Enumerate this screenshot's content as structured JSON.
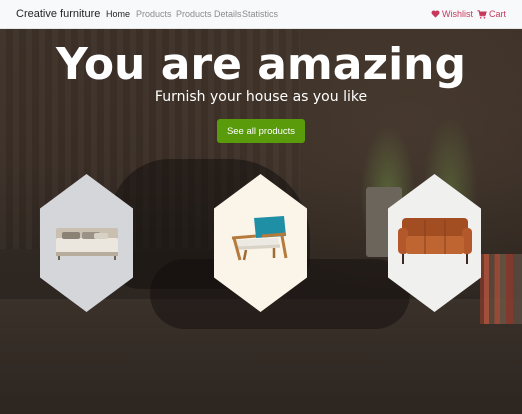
{
  "navbar": {
    "brand": "Creative furniture",
    "links": [
      {
        "label": "Home",
        "active": true
      },
      {
        "label": "Products",
        "active": false
      },
      {
        "label": "Products Details",
        "active": false
      },
      {
        "label": "Statistics",
        "active": false
      }
    ],
    "wishlist": {
      "label": "Wishlist",
      "icon": "heart-icon"
    },
    "cart": {
      "label": "Cart",
      "icon": "cart-icon"
    }
  },
  "hero": {
    "title": "You are amazing",
    "subtitle": "Furnish your house as you like",
    "cta_label": "See all products"
  },
  "products": [
    {
      "item": "bed",
      "background": "#d5d6da"
    },
    {
      "item": "armchair",
      "background": "#fbf4e8"
    },
    {
      "item": "sofa",
      "background": "#f0f0ef"
    }
  ],
  "colors": {
    "accent_green": "#5a9b0c",
    "nav_accent": "#c8385b",
    "navbar_bg": "#f8f9fa"
  }
}
